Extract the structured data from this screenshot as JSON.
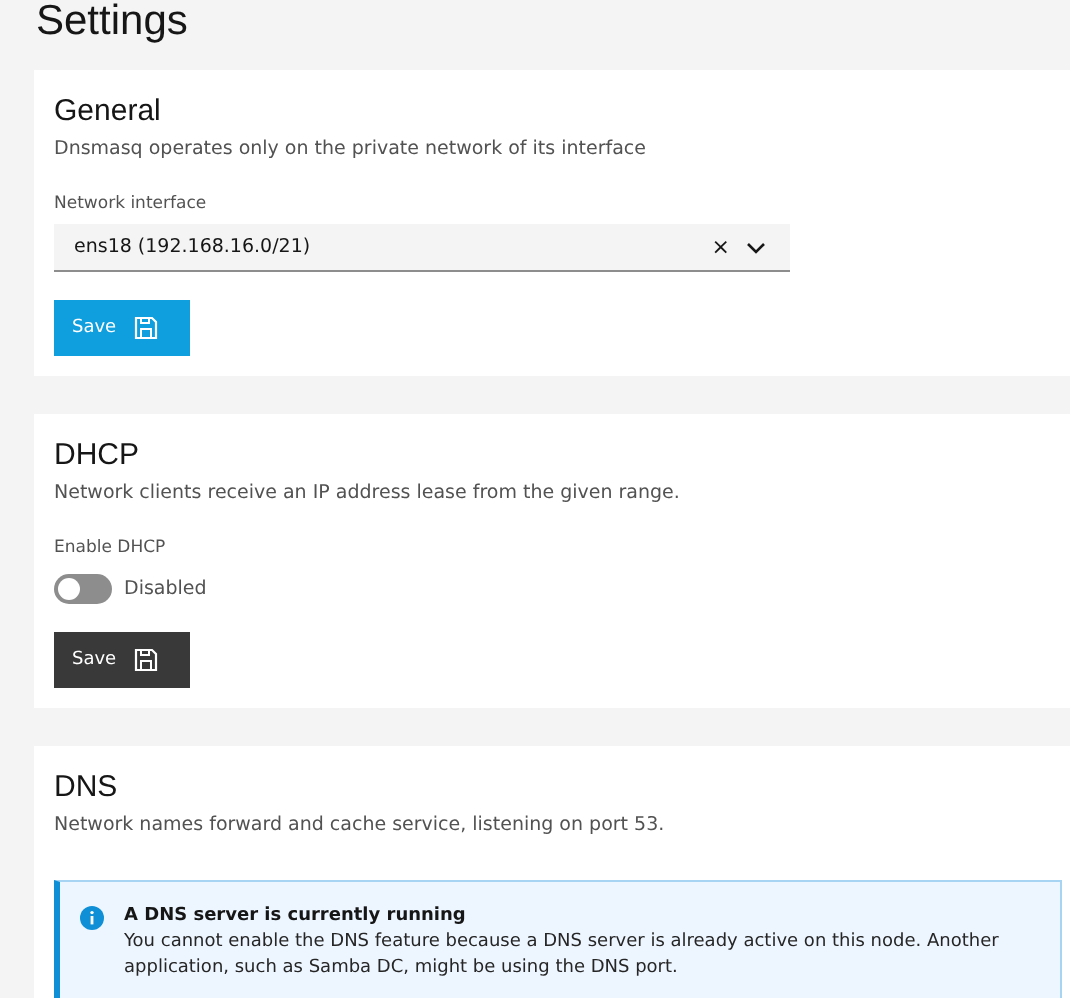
{
  "page_title": "Settings",
  "sections": [
    {
      "kind": "select",
      "title": "General",
      "description": "Dnsmasq operates only on the private network of its interface",
      "field_label": "Network interface",
      "value": "ens18 (192.168.16.0/21)",
      "clear_icon": "×",
      "button": {
        "label": "Save",
        "kind": "primary"
      }
    },
    {
      "kind": "toggle",
      "title": "DHCP",
      "description": "Network clients receive an IP address lease from the given range.",
      "field_label": "Enable DHCP",
      "on": false,
      "state_text": "Disabled",
      "button": {
        "label": "Save",
        "kind": "secondary"
      }
    },
    {
      "kind": "notice",
      "title": "DNS",
      "description": "Network names forward and cache service, listening on port 53.",
      "notice": {
        "title": "A DNS server is currently running",
        "text": "You cannot enable the DNS feature because a DNS server is already active on this node. Another application, such as Samba DC, might be using the DNS port."
      }
    }
  ]
}
